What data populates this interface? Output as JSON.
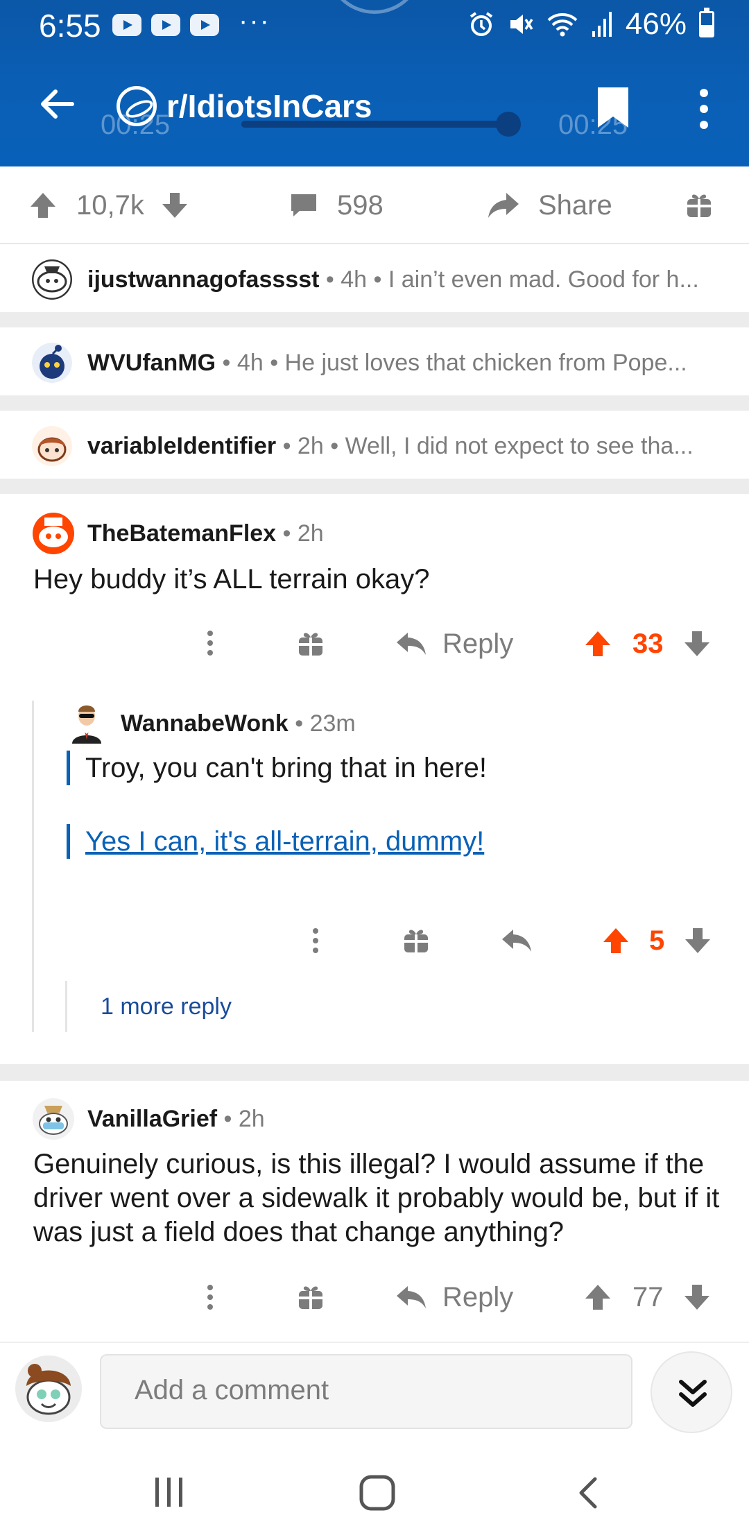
{
  "status": {
    "time": "6:55",
    "more": "···",
    "battery": "46%"
  },
  "appbar": {
    "subreddit": "r/IdiotsInCars",
    "video_time_left": "00:25",
    "video_time_right": "00:25",
    "video_progress_pct": 100
  },
  "post_actions": {
    "score": "10,7k",
    "comments": "598",
    "share": "Share"
  },
  "collapsed_comments": [
    {
      "user": "ijustwannagofasssst",
      "age": "4h",
      "preview": "I ain’t even mad. Good for h..."
    },
    {
      "user": "WVUfanMG",
      "age": "4h",
      "preview": "He just loves that chicken from Pope..."
    },
    {
      "user": "variableIdentifier",
      "age": "2h",
      "preview": "Well, I did not expect to see tha..."
    }
  ],
  "comment1": {
    "user": "TheBatemanFlex",
    "age": "2h",
    "text": "Hey buddy it’s ALL terrain okay?",
    "reply_label": "Reply",
    "score": "33"
  },
  "reply1": {
    "user": "WannabeWonk",
    "age": "23m",
    "quote1": "Troy, you can't bring that in here!",
    "quote2": "Yes I can, it's all-terrain, dummy!",
    "score": "5",
    "more_replies": "1 more reply"
  },
  "comment2": {
    "user": "VanillaGrief",
    "age": "2h",
    "text": "Genuinely curious, is this illegal? I would assume if the driver went over a sidewalk it probably would be, but if it was just a field does that change anything?",
    "reply_label": "Reply",
    "score": "77"
  },
  "composer": {
    "placeholder": "Add a comment"
  },
  "colors": {
    "header": "#0a5aae",
    "upvote": "#ff4500",
    "link": "#0a62b6",
    "muted": "#7c7c7c"
  },
  "icons": [
    "back-arrow-icon",
    "subreddit-planet-icon",
    "bookmark-icon",
    "overflow-icon",
    "upvote-icon",
    "downvote-icon",
    "comment-icon",
    "share-icon",
    "award-icon",
    "reply-icon",
    "chevrons-down-icon"
  ]
}
